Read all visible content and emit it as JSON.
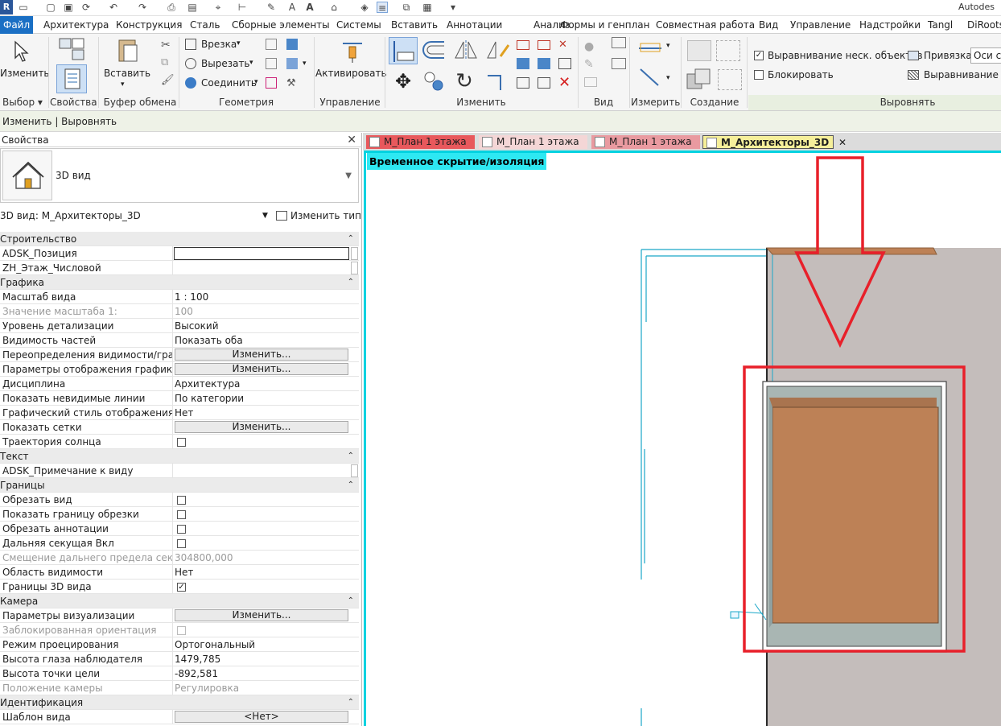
{
  "app": {
    "title_fragment": "Autodes",
    "logo": "R"
  },
  "menu": {
    "tabs": [
      "Файл",
      "Архитектура",
      "Конструкция",
      "Сталь",
      "Сборные элементы",
      "Системы",
      "Вставить",
      "Аннотации",
      "Анализ",
      "Формы и генплан",
      "Совместная работа",
      "Вид",
      "Управление",
      "Надстройки",
      "Tangl",
      "DiRootsO"
    ]
  },
  "ribbon": {
    "modify": "Изменить",
    "select": "Выбор ▾",
    "properties": "Свойства",
    "paste": "Вставить",
    "clipboard": "Буфер обмена",
    "cope": "Врезка",
    "cut": "Вырезать",
    "join": "Соединить",
    "geometry": "Геометрия",
    "activate": "Активировать",
    "control": "Управление",
    "modify_group": "Изменить",
    "view": "Вид",
    "measure": "Измерить",
    "create": "Создание",
    "align_multi": "Выравнивание неск. объектов",
    "lock": "Блокировать",
    "snap_label": "Привязка:",
    "snap_value": "Оси с",
    "align_hatch": "Выравнивание ш",
    "align_group": "Выровнять"
  },
  "options_bar": {
    "text": "Изменить | Выровнять"
  },
  "properties": {
    "header": "Свойства",
    "type_name": "3D вид",
    "instance": "3D вид: М_Архитекторы_3D",
    "edit_type": "Изменить тип",
    "rows": [
      {
        "kind": "sec",
        "name": "Строительство"
      },
      {
        "kind": "text",
        "name": "ADSK_Позиция",
        "value": ""
      },
      {
        "kind": "plain",
        "name": "ZH_Этаж_Числовой",
        "value": ""
      },
      {
        "kind": "sec",
        "name": "Графика"
      },
      {
        "kind": "plain",
        "name": "Масштаб вида",
        "value": "1 : 100"
      },
      {
        "kind": "grey",
        "name": "Значение масштаба    1:",
        "value": "100"
      },
      {
        "kind": "plain",
        "name": "Уровень детализации",
        "value": "Высокий"
      },
      {
        "kind": "plain",
        "name": "Видимость частей",
        "value": "Показать оба"
      },
      {
        "kind": "btn",
        "name": "Переопределения видимости/графи...",
        "value": "Изменить..."
      },
      {
        "kind": "btn",
        "name": "Параметры отображения графики",
        "value": "Изменить..."
      },
      {
        "kind": "plain",
        "name": "Дисциплина",
        "value": "Архитектура"
      },
      {
        "kind": "plain",
        "name": "Показать невидимые линии",
        "value": "По категории"
      },
      {
        "kind": "plain",
        "name": "Графический стиль отображения ра...",
        "value": "Нет"
      },
      {
        "kind": "btn",
        "name": "Показать сетки",
        "value": "Изменить..."
      },
      {
        "kind": "chk",
        "name": "Траектория солнца",
        "value": ""
      },
      {
        "kind": "sec",
        "name": "Текст"
      },
      {
        "kind": "plainsb",
        "name": "ADSK_Примечание к виду",
        "value": ""
      },
      {
        "kind": "sec",
        "name": "Границы"
      },
      {
        "kind": "chk",
        "name": "Обрезать вид",
        "value": ""
      },
      {
        "kind": "chk",
        "name": "Показать границу обрезки",
        "value": ""
      },
      {
        "kind": "chk",
        "name": "Обрезать аннотации",
        "value": ""
      },
      {
        "kind": "chk",
        "name": "Дальняя секущая Вкл",
        "value": ""
      },
      {
        "kind": "grey",
        "name": "Смещение дальнего предела секущ...",
        "value": "304800,000"
      },
      {
        "kind": "plain",
        "name": "Область видимости",
        "value": "Нет"
      },
      {
        "kind": "chkon",
        "name": "Границы 3D вида",
        "value": "✓"
      },
      {
        "kind": "sec",
        "name": "Камера"
      },
      {
        "kind": "btn",
        "name": "Параметры визуализации",
        "value": "Изменить..."
      },
      {
        "kind": "chkgrey",
        "name": "Заблокированная ориентация",
        "value": ""
      },
      {
        "kind": "plain",
        "name": "Режим проецирования",
        "value": "Ортогональный"
      },
      {
        "kind": "plain",
        "name": "Высота глаза наблюдателя",
        "value": "1479,785"
      },
      {
        "kind": "plain",
        "name": "Высота точки цели",
        "value": "-892,581"
      },
      {
        "kind": "grey",
        "name": "Положение камеры",
        "value": "Регулировка"
      },
      {
        "kind": "sec",
        "name": "Идентификация"
      },
      {
        "kind": "btn",
        "name": "Шаблон вида",
        "value": "<Нет>"
      }
    ]
  },
  "view_tabs": [
    {
      "label": "М_План 1 этажа",
      "color": "#e8585c"
    },
    {
      "label": "М_План 1 этажа",
      "color": "#f4d6d6"
    },
    {
      "label": "М_План 1 этажа",
      "color": "#e99aa0"
    },
    {
      "label": "М_Архитекторы_3D",
      "color": "#f6ef9a",
      "active": true
    }
  ],
  "canvas": {
    "banner": "Временное скрытие/изоляция"
  },
  "colors": {
    "accent": "#1a6fc4",
    "cyan": "#00d2e0",
    "annotation": "#e8202a",
    "wood": "#bd8156",
    "wall": "#c4bdbb"
  }
}
